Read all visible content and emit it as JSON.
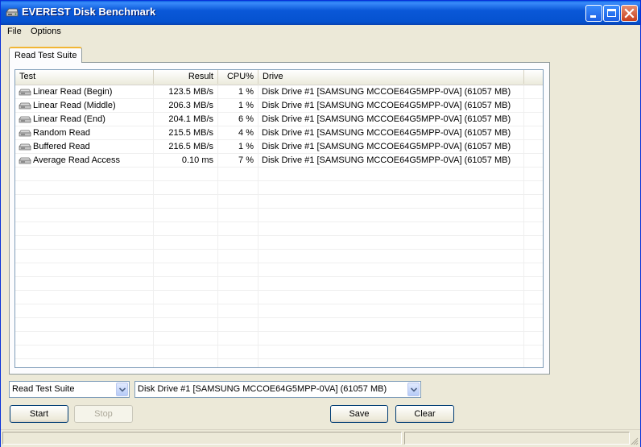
{
  "window": {
    "title": "EVEREST Disk Benchmark",
    "icon": "disk-drive-icon"
  },
  "menu": {
    "file": "File",
    "options": "Options"
  },
  "tabs": [
    {
      "label": "Read Test Suite"
    }
  ],
  "table": {
    "headers": {
      "test": "Test",
      "result": "Result",
      "cpu": "CPU%",
      "drive": "Drive"
    },
    "rows": [
      {
        "test": "Linear Read (Begin)",
        "result": "123.5 MB/s",
        "cpu": "1 %",
        "drive": "Disk Drive #1  [SAMSUNG MCCOE64G5MPP-0VA]  (61057 MB)"
      },
      {
        "test": "Linear Read (Middle)",
        "result": "206.3 MB/s",
        "cpu": "1 %",
        "drive": "Disk Drive #1  [SAMSUNG MCCOE64G5MPP-0VA]  (61057 MB)"
      },
      {
        "test": "Linear Read (End)",
        "result": "204.1 MB/s",
        "cpu": "6 %",
        "drive": "Disk Drive #1  [SAMSUNG MCCOE64G5MPP-0VA]  (61057 MB)"
      },
      {
        "test": "Random Read",
        "result": "215.5 MB/s",
        "cpu": "4 %",
        "drive": "Disk Drive #1  [SAMSUNG MCCOE64G5MPP-0VA]  (61057 MB)"
      },
      {
        "test": "Buffered Read",
        "result": "216.5 MB/s",
        "cpu": "1 %",
        "drive": "Disk Drive #1  [SAMSUNG MCCOE64G5MPP-0VA]  (61057 MB)"
      },
      {
        "test": "Average Read Access",
        "result": "0.10 ms",
        "cpu": "7 %",
        "drive": "Disk Drive #1  [SAMSUNG MCCOE64G5MPP-0VA]  (61057 MB)"
      }
    ]
  },
  "controls": {
    "suite_select": "Read Test Suite",
    "drive_select": "Disk Drive #1  [SAMSUNG MCCOE64G5MPP-0VA]  (61057 MB)",
    "start": "Start",
    "stop": "Stop",
    "save": "Save",
    "clear": "Clear"
  },
  "colors": {
    "titlebar": "#0a58d8",
    "window_bg": "#ece9d8",
    "tab_accent": "#f1b636"
  }
}
